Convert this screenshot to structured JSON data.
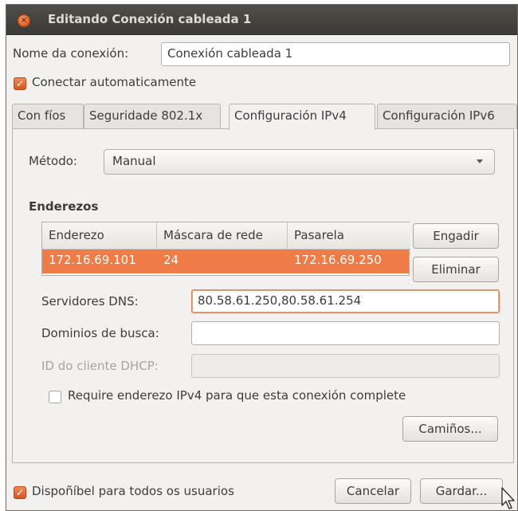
{
  "window": {
    "title": "Editando Conexión cableada 1"
  },
  "connection": {
    "name_label": "Nome da conexión:",
    "name_value": "Conexión cableada 1",
    "auto_connect_label": "Conectar automaticamente",
    "auto_connect_checked": true
  },
  "tabs": [
    {
      "label": "Con fíos",
      "active": false
    },
    {
      "label": "Seguridade 802.1x",
      "active": false
    },
    {
      "label": "Configuración IPv4",
      "active": true
    },
    {
      "label": "Configuración IPv6",
      "active": false
    }
  ],
  "ipv4": {
    "method_label": "Método:",
    "method_value": "Manual",
    "addresses_heading": "Enderezos",
    "columns": [
      "Enderezo",
      "Máscara de rede",
      "Pasarela"
    ],
    "rows": [
      {
        "address": "172.16.69.101",
        "netmask": "24",
        "gateway": "172.16.69.250",
        "selected": true
      }
    ],
    "add_button": "Engadir",
    "delete_button": "Eliminar",
    "dns_label": "Servidores DNS:",
    "dns_value": "80.58.61.250,80.58.61.254",
    "search_domains_label": "Dominios de busca:",
    "search_domains_value": "",
    "dhcp_client_id_label": "ID do cliente DHCP:",
    "dhcp_client_id_value": "",
    "require_ipv4_label": "Require enderezo IPv4 para que esta conexión complete",
    "require_ipv4_checked": false,
    "routes_button": "Camiños..."
  },
  "footer": {
    "all_users_label": "Dispoñíbel para todos os usuarios",
    "all_users_checked": true,
    "cancel_button": "Cancelar",
    "save_button": "Gardar..."
  },
  "colors": {
    "accent": "#ef7c47",
    "titlebar": "#3b3a36"
  }
}
